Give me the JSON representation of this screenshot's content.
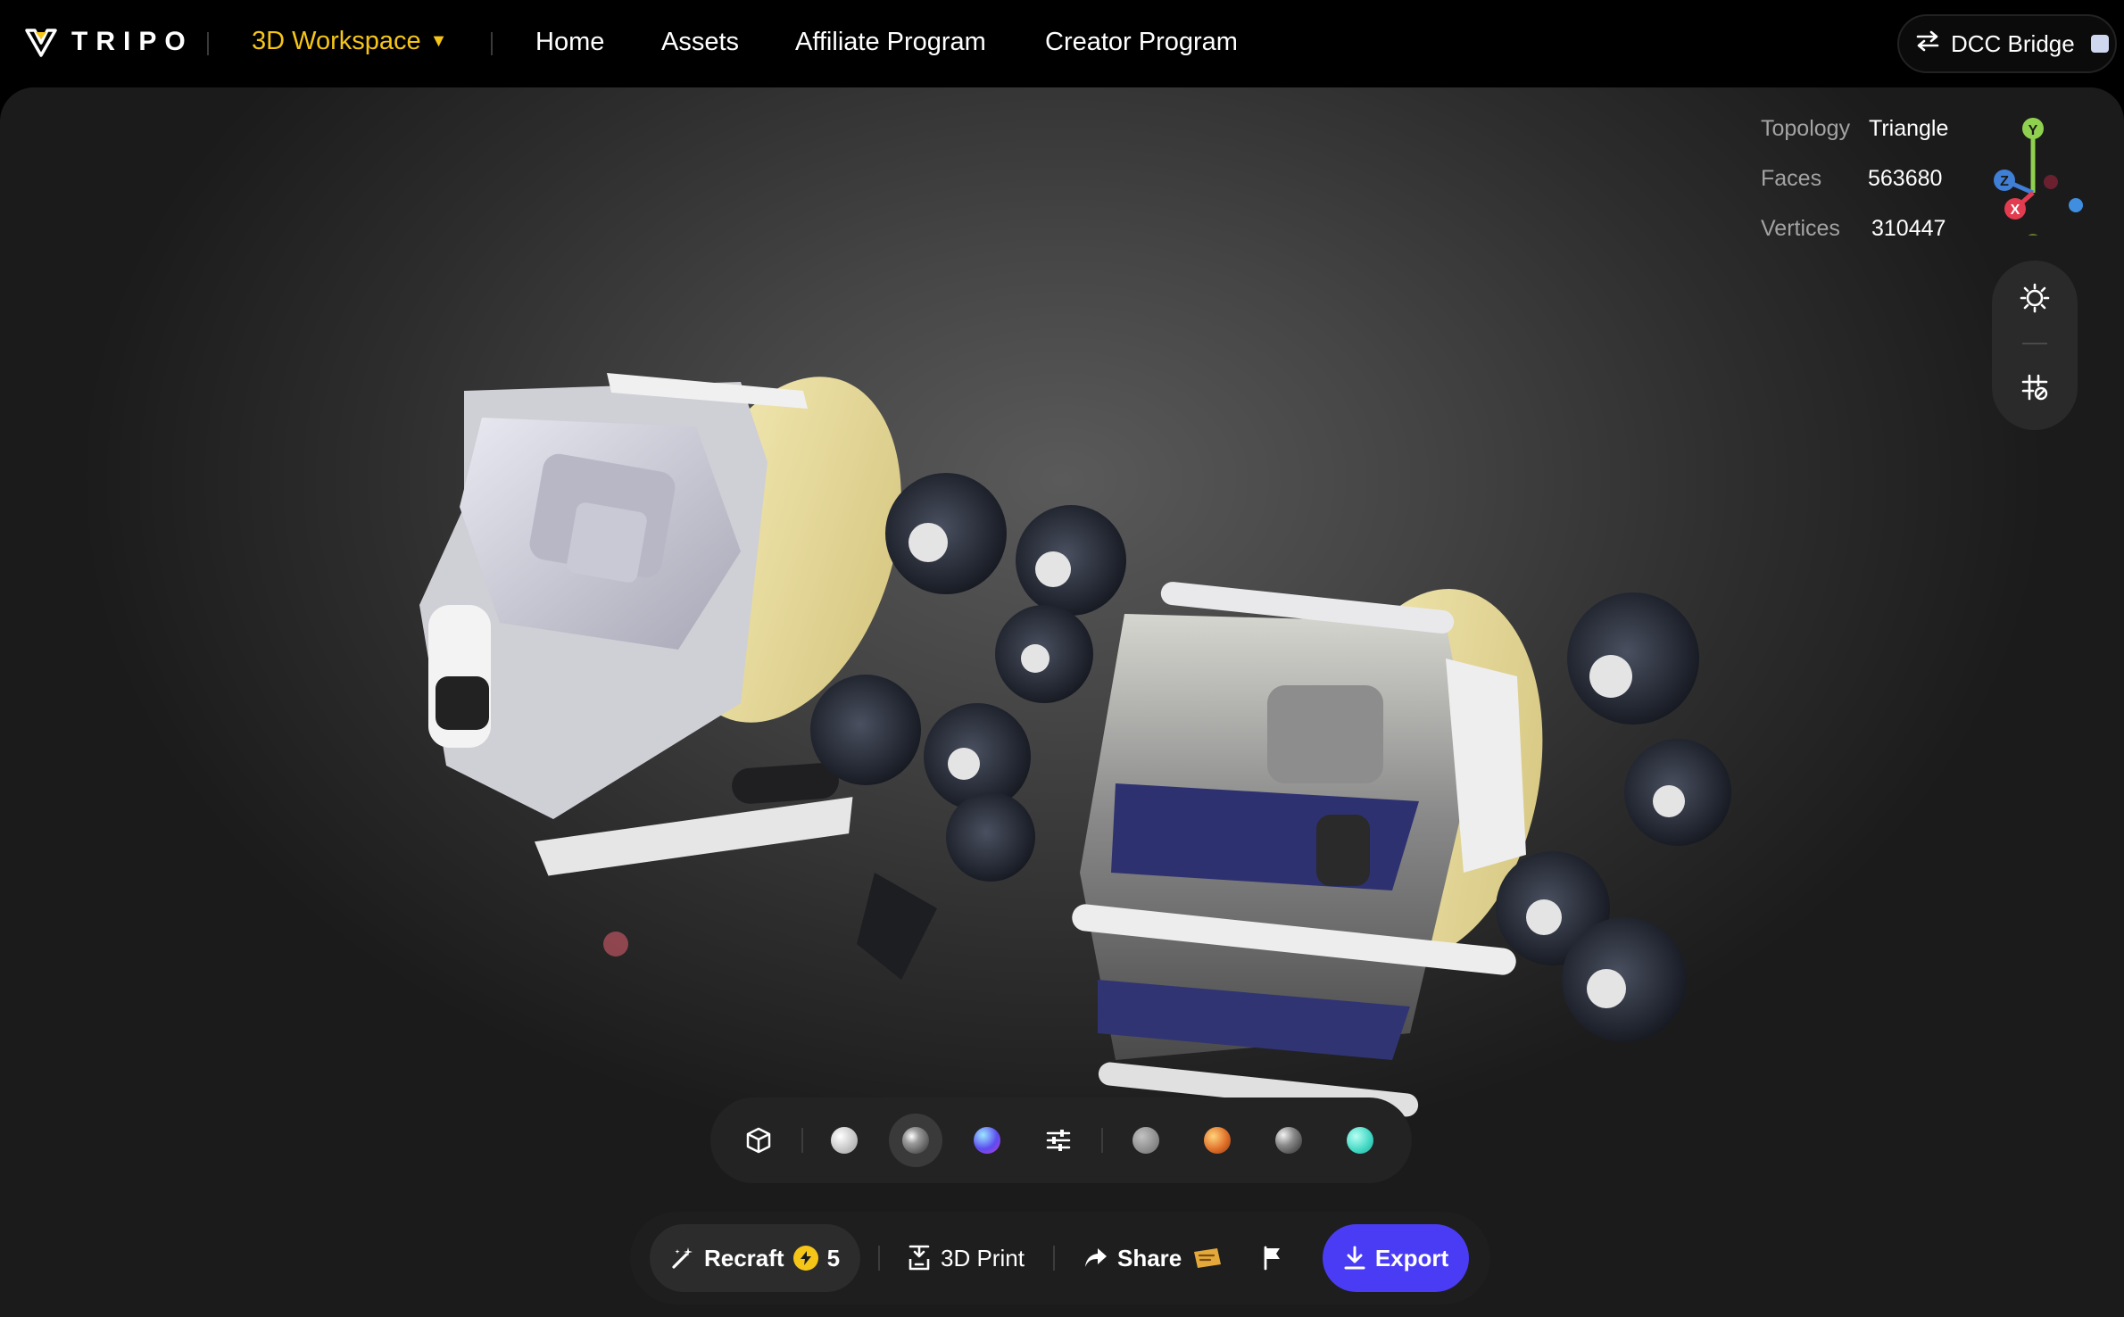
{
  "header": {
    "logo_text": "TRIPO",
    "workspace_label": "3D Workspace",
    "nav": [
      "Home",
      "Assets",
      "Affiliate Program",
      "Creator Program"
    ],
    "dcc_bridge_label": "DCC Bridge"
  },
  "stats": [
    {
      "label": "Topology",
      "value": "Triangle"
    },
    {
      "label": "Faces",
      "value": "563680"
    },
    {
      "label": "Vertices",
      "value": "310447"
    }
  ],
  "gizmo": {
    "y": "Y",
    "z": "Z",
    "x": "X"
  },
  "actions": {
    "recraft_label": "Recraft",
    "recraft_cost": "5",
    "print_label": "3D Print",
    "share_label": "Share",
    "export_label": "Export"
  },
  "colors": {
    "accent": "#f5c518",
    "export": "#4a3cf5",
    "sidebar": "#2a2a2a"
  },
  "icons": {
    "material_bar": [
      "cube-icon",
      "white-sphere-icon",
      "glossy-sphere-icon",
      "gradient-sphere-icon",
      "sliders-icon",
      "gray-sphere-icon",
      "orange-sphere-icon",
      "metal-sphere-icon",
      "teal-sphere-icon"
    ],
    "sidebar": [
      "light-icon",
      "grid-toggle-icon"
    ],
    "actions": [
      "magic-wand-icon",
      "bolt-icon",
      "print-icon",
      "share-arrow-icon",
      "ticket-icon",
      "flag-icon",
      "download-icon"
    ]
  }
}
